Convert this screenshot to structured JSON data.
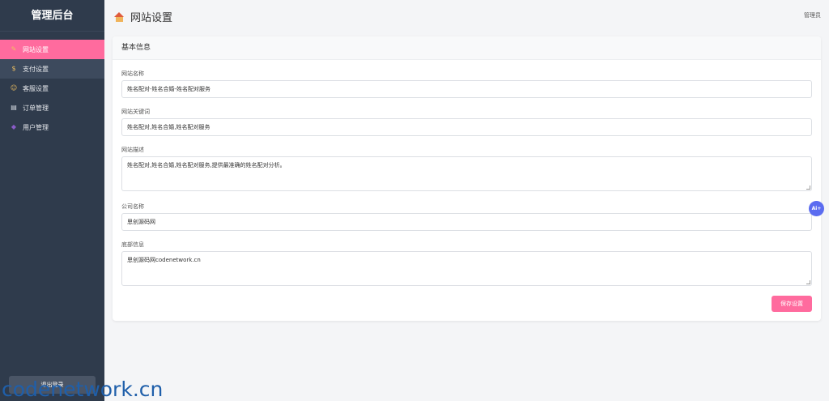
{
  "sidebar": {
    "brand": "管理后台",
    "items": [
      {
        "label": "网站设置",
        "icon": "wrench-icon",
        "glyph": "✎"
      },
      {
        "label": "支付设置",
        "icon": "money-bag-icon",
        "glyph": "$"
      },
      {
        "label": "客服设置",
        "icon": "user-icon",
        "glyph": "☺"
      },
      {
        "label": "订单管理",
        "icon": "document-icon",
        "glyph": "▤"
      },
      {
        "label": "用户管理",
        "icon": "users-icon",
        "glyph": "◆"
      }
    ],
    "logout_label": "退出登录"
  },
  "header": {
    "title": "网站设置",
    "user": "管理员"
  },
  "form": {
    "section_title": "基本信息",
    "site_name_label": "网站名称",
    "site_name_value": "姓名配对-姓名合婚-姓名配对服务",
    "keywords_label": "网站关键词",
    "keywords_value": "姓名配对,姓名合婚,姓名配对服务",
    "description_label": "网站描述",
    "description_value": "姓名配对,姓名合婚,姓名配对服务,提供最准确的姓名配对分析。",
    "company_label": "公司名称",
    "company_value": "思创源码网",
    "footer_label": "底部信息",
    "footer_value": "思创源码网codenetwork.cn",
    "save_label": "保存设置"
  },
  "ai_badge": "Ai+",
  "watermark": "codenetwork.cn",
  "colors": {
    "accent": "#ff6b9e",
    "sidebar": "#2f3b4c"
  }
}
